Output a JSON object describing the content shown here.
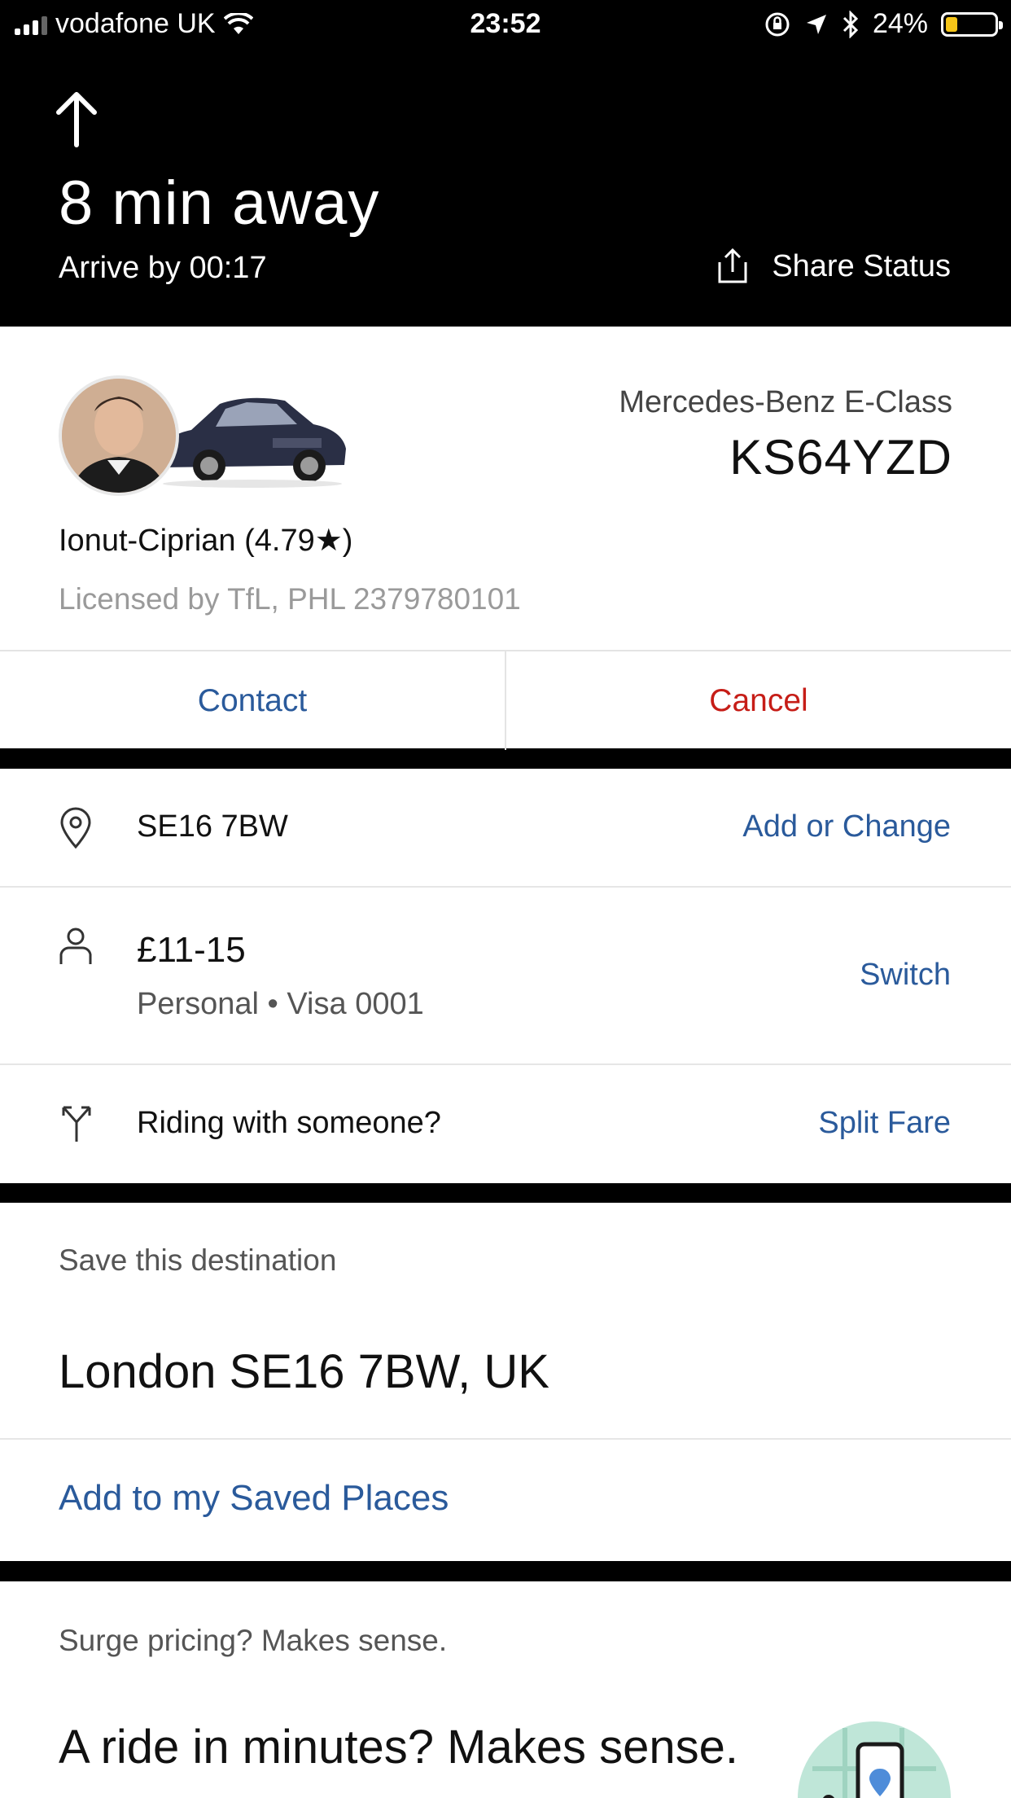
{
  "status_bar": {
    "carrier": "vodafone UK",
    "time": "23:52",
    "battery_percent_label": "24%",
    "battery_level": 0.24
  },
  "header": {
    "eta": "8 min away",
    "arrive_by": "Arrive by 00:17",
    "share_label": "Share Status"
  },
  "driver": {
    "car_model": "Mercedes-Benz E-Class",
    "plate": "KS64YZD",
    "name_rating": "Ionut-Ciprian (4.79★)",
    "license": "Licensed by TfL, PHL 2379780101",
    "contact_label": "Contact",
    "cancel_label": "Cancel"
  },
  "trip": {
    "destination": "SE16 7BW",
    "destination_action": "Add or Change",
    "fare": "£11-15",
    "payment": "Personal • Visa 0001",
    "payment_action": "Switch",
    "split_prompt": "Riding with someone?",
    "split_action": "Split Fare"
  },
  "save_destination": {
    "heading": "Save this destination",
    "address": "London SE16 7BW, UK",
    "action": "Add to my Saved Places"
  },
  "promo": {
    "heading": "Surge pricing? Makes sense.",
    "title": "A ride in minutes? Makes sense."
  },
  "colors": {
    "link_blue": "#2a5a9b",
    "cancel_red": "#c61d17",
    "battery_yellow": "#f5c518"
  }
}
